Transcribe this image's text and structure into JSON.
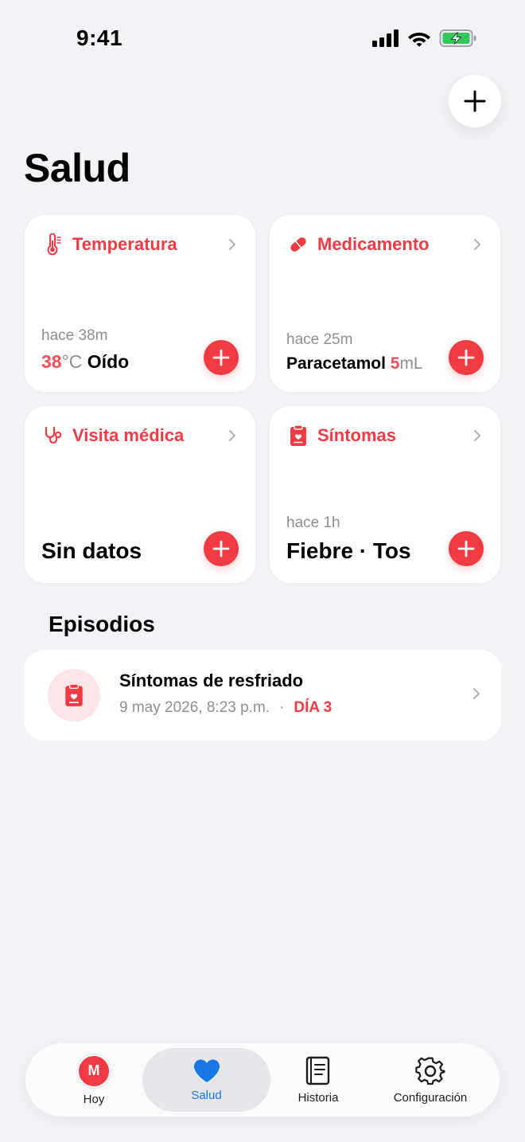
{
  "status_bar": {
    "time": "9:41"
  },
  "header": {
    "title": "Salud"
  },
  "cards": [
    {
      "title": "Temperatura",
      "icon": "thermometer-icon",
      "meta": "hace 38m",
      "value_number": "38",
      "value_unit": "°C",
      "value_site": "Oído"
    },
    {
      "title": "Medicamento",
      "icon": "pill-icon",
      "meta": "hace 25m",
      "value_name": "Paracetamol",
      "value_amount": "5",
      "value_unit": "mL"
    },
    {
      "title": "Visita médica",
      "icon": "stethoscope-icon",
      "value": "Sin datos"
    },
    {
      "title": "Síntomas",
      "icon": "clipboard-icon",
      "meta": "hace 1h",
      "value": "Fiebre · Tos"
    }
  ],
  "episodes": {
    "title": "Episodios",
    "items": [
      {
        "title": "Síntomas de resfriado",
        "date": "9 may 2026, 8:23 p.m.",
        "separator": "·",
        "day": "DÍA 3"
      }
    ]
  },
  "tab_bar": {
    "tabs": [
      {
        "label": "Hoy",
        "avatar_initial": "M"
      },
      {
        "label": "Salud",
        "icon": "heart-icon"
      },
      {
        "label": "Historia",
        "icon": "notebook-icon"
      },
      {
        "label": "Configuración",
        "icon": "gear-icon"
      }
    ],
    "active": "Salud"
  },
  "colors": {
    "accent": "#f23a43",
    "active_tab": "#1877e6",
    "background": "#f2f2f7"
  }
}
